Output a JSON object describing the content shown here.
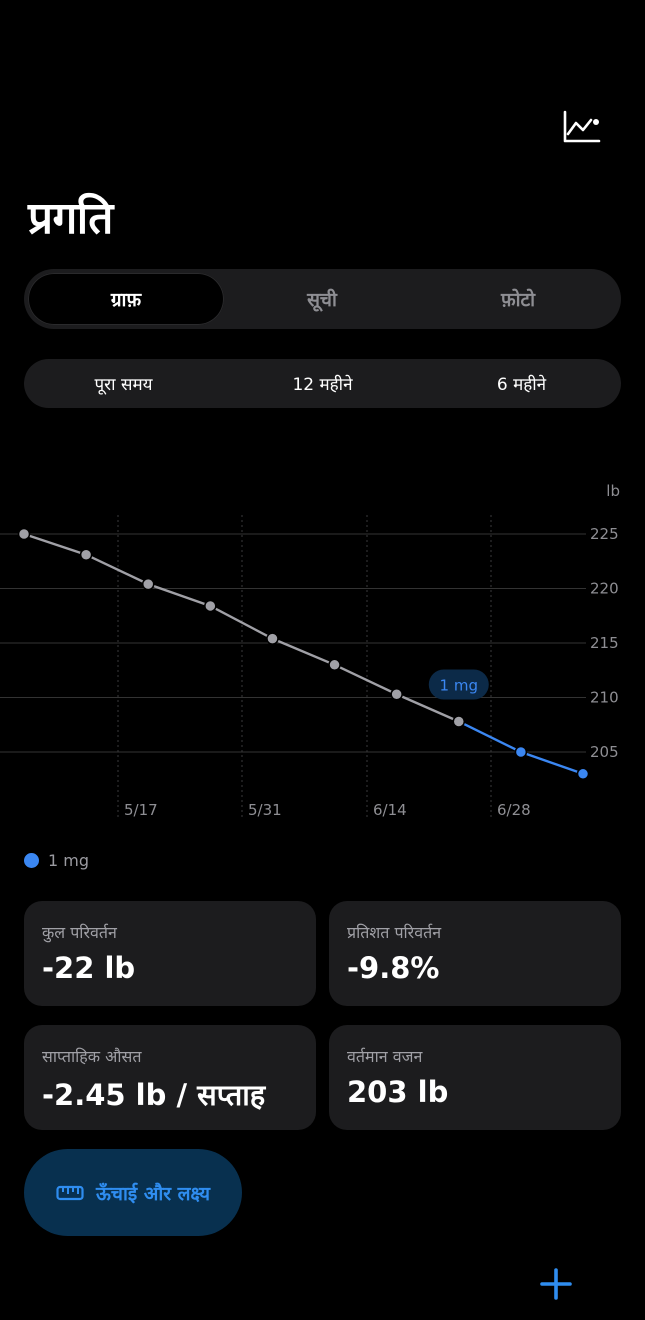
{
  "header": {
    "title": "प्रगति",
    "trend_icon": "line-chart-icon"
  },
  "tabs": [
    {
      "label": "ग्राफ़",
      "active": true
    },
    {
      "label": "सूची",
      "active": false
    },
    {
      "label": "फ़ोटो",
      "active": false
    }
  ],
  "ranges": [
    {
      "label": "पूरा समय"
    },
    {
      "label": "12 महीने"
    },
    {
      "label": "6 महीने"
    }
  ],
  "chart_data": {
    "type": "line",
    "y_unit": "lb",
    "ylim": [
      200,
      227
    ],
    "y_ticks": [
      "225",
      "220",
      "215",
      "210",
      "205"
    ],
    "x_tick_labels": [
      "5/17",
      "5/31",
      "6/14",
      "6/28"
    ],
    "series": [
      {
        "name": "1 mg",
        "color": "#3b87f2",
        "points": [
          {
            "x": 0,
            "y": 225.0
          },
          {
            "x": 1,
            "y": 223.1
          },
          {
            "x": 2,
            "y": 220.4
          },
          {
            "x": 3,
            "y": 218.4
          },
          {
            "x": 4,
            "y": 215.4
          },
          {
            "x": 5,
            "y": 213.0
          },
          {
            "x": 6,
            "y": 210.3
          },
          {
            "x": 7,
            "y": 207.8
          },
          {
            "x": 8,
            "y": 205.0
          },
          {
            "x": 9,
            "y": 203.0
          }
        ],
        "highlight_from_index": 7
      }
    ],
    "annotation": "1 mg",
    "grid": true
  },
  "legend": {
    "label": "1 mg",
    "color": "#3b87f2"
  },
  "stats": [
    {
      "label": "कुल परिवर्तन",
      "value": "-22 lb"
    },
    {
      "label": "प्रतिशत परिवर्तन",
      "value": "-9.8%"
    },
    {
      "label": "साप्ताहिक औसत",
      "value": "-2.45 lb / सप्ताह"
    },
    {
      "label": "वर्तमान वजन",
      "value": "203 lb"
    }
  ],
  "goal_button": {
    "label": "ऊँचाई और लक्ष्य",
    "icon": "ruler-icon"
  },
  "add_button": {
    "icon": "plus-icon"
  },
  "colors": {
    "accent": "#3b87f2",
    "point_gray": "#a0a0a6"
  }
}
